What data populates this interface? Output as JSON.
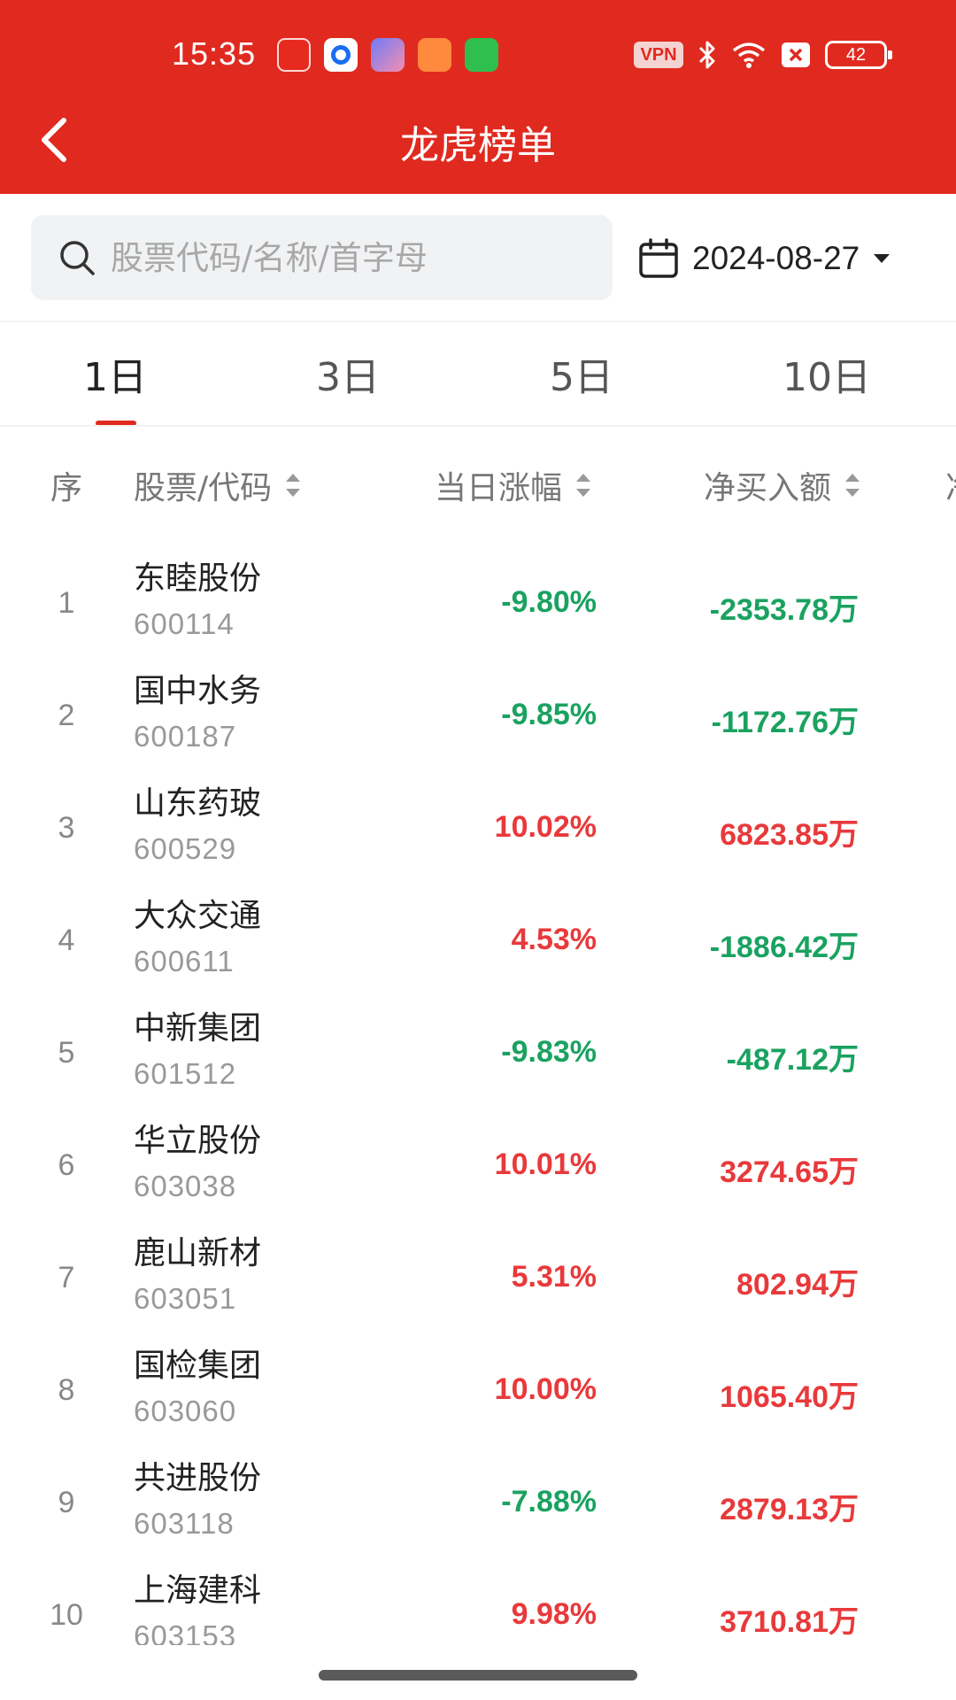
{
  "status": {
    "time": "15:35",
    "vpn": "VPN",
    "battery": "42"
  },
  "header": {
    "title": "龙虎榜单"
  },
  "search": {
    "placeholder": "股票代码/名称/首字母"
  },
  "date": {
    "value": "2024-08-27"
  },
  "tabs": [
    {
      "label": "1日",
      "active": true
    },
    {
      "label": "3日",
      "active": false
    },
    {
      "label": "5日",
      "active": false
    },
    {
      "label": "10日",
      "active": false
    }
  ],
  "table": {
    "headers": {
      "index": "序",
      "stock": "股票/代码",
      "change": "当日涨幅",
      "net_buy": "净买入额",
      "more": "净"
    },
    "rows": [
      {
        "idx": "1",
        "name": "东睦股份",
        "code": "600114",
        "change": "-9.80%",
        "net": "-2353.78万"
      },
      {
        "idx": "2",
        "name": "国中水务",
        "code": "600187",
        "change": "-9.85%",
        "net": "-1172.76万"
      },
      {
        "idx": "3",
        "name": "山东药玻",
        "code": "600529",
        "change": "10.02%",
        "net": "6823.85万"
      },
      {
        "idx": "4",
        "name": "大众交通",
        "code": "600611",
        "change": "4.53%",
        "net": "-1886.42万"
      },
      {
        "idx": "5",
        "name": "中新集团",
        "code": "601512",
        "change": "-9.83%",
        "net": "-487.12万"
      },
      {
        "idx": "6",
        "name": "华立股份",
        "code": "603038",
        "change": "10.01%",
        "net": "3274.65万"
      },
      {
        "idx": "7",
        "name": "鹿山新材",
        "code": "603051",
        "change": "5.31%",
        "net": "802.94万"
      },
      {
        "idx": "8",
        "name": "国检集团",
        "code": "603060",
        "change": "10.00%",
        "net": "1065.40万"
      },
      {
        "idx": "9",
        "name": "共进股份",
        "code": "603118",
        "change": "-7.88%",
        "net": "2879.13万"
      },
      {
        "idx": "10",
        "name": "上海建科",
        "code": "603153",
        "change": "9.98%",
        "net": "3710.81万"
      }
    ]
  },
  "colors": {
    "brand_red": "#e02a1f",
    "up": "#e8393b",
    "down": "#1aa260"
  }
}
